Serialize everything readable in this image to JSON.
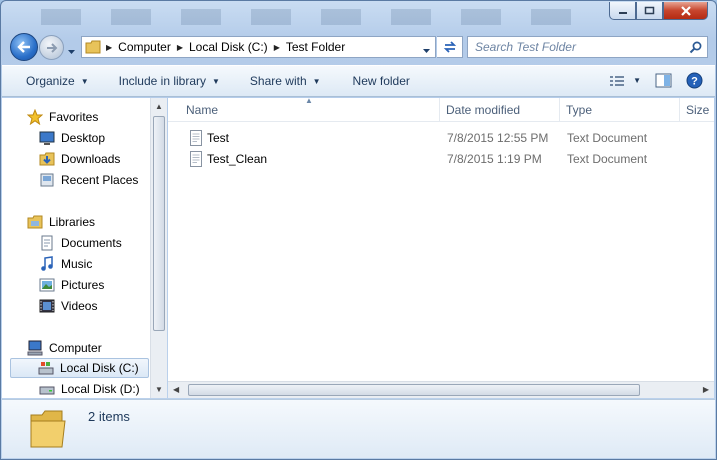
{
  "titlebar": {
    "buttons": [
      "minimize",
      "maximize",
      "close"
    ]
  },
  "address": {
    "crumbs": [
      {
        "label": "Computer"
      },
      {
        "label": "Local Disk (C:)"
      },
      {
        "label": "Test Folder"
      }
    ]
  },
  "search": {
    "placeholder": "Search Test Folder"
  },
  "commands": {
    "organize": "Organize",
    "include_in_library": "Include in library",
    "share_with": "Share with",
    "new_folder": "New folder"
  },
  "nav": {
    "favorites": "Favorites",
    "desktop": "Desktop",
    "downloads": "Downloads",
    "recent_places": "Recent Places",
    "libraries": "Libraries",
    "documents": "Documents",
    "music": "Music",
    "pictures": "Pictures",
    "videos": "Videos",
    "computer": "Computer",
    "local_disk_c": "Local Disk (C:)",
    "local_disk_d": "Local Disk (D:)"
  },
  "columns": {
    "name": "Name",
    "date_modified": "Date modified",
    "type": "Type",
    "size": "Size"
  },
  "files": [
    {
      "name": "Test",
      "date": "7/8/2015 12:55 PM",
      "type": "Text Document"
    },
    {
      "name": "Test_Clean",
      "date": "7/8/2015 1:19 PM",
      "type": "Text Document"
    }
  ],
  "details": {
    "count": "2 items"
  },
  "colors": {
    "accent": "#1e395b",
    "selection": "#dbe8f6",
    "pane": "#dfeaf6"
  }
}
